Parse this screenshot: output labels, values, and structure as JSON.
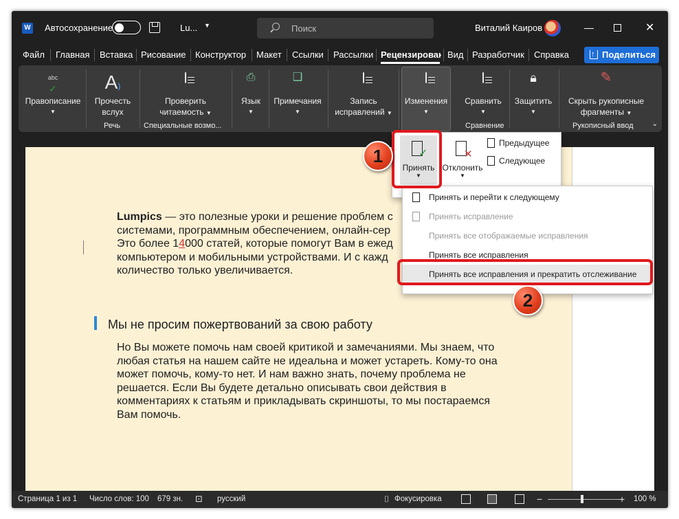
{
  "titlebar": {
    "app_icon_letter": "W",
    "autosave_label": "Автосохранение",
    "filename": "Lu...",
    "search_placeholder": "Поиск",
    "username": "Виталий Каиров"
  },
  "tabs": [
    "Файл",
    "Главная",
    "Вставка",
    "Рисование",
    "Конструктор",
    "Макет",
    "Ссылки",
    "Рассылки",
    "Рецензирование",
    "Вид",
    "Разработчик",
    "Справка"
  ],
  "active_tab": "Рецензирование",
  "share_label": "Поделиться",
  "ribbon": {
    "spelling": "Правописание",
    "read_aloud_1": "Прочесть",
    "read_aloud_2": "вслух",
    "check_access_1": "Проверить",
    "check_access_2": "читаемость",
    "language": "Язык",
    "comments": "Примечания",
    "track_1": "Запись",
    "track_2": "исправлений",
    "changes": "Изменения",
    "compare": "Сравнить",
    "protect": "Защитить",
    "hide_ink_1": "Скрыть рукописные",
    "hide_ink_2": "фрагменты",
    "group_speech": "Речь",
    "group_access": "Специальные возмо...",
    "group_compare": "Сравнение",
    "group_ink": "Рукописный ввод",
    "spelling_sub": "abc"
  },
  "changes_panel": {
    "accept": "Принять",
    "reject": "Отклонить",
    "previous": "Предыдущее",
    "next": "Следующее"
  },
  "accept_menu": [
    "Принять и перейти к следующему",
    "Принять исправление",
    "Принять все отображаемые исправления",
    "Принять все исправления",
    "Принять все исправления и прекратить отслеживание"
  ],
  "document": {
    "p1_bold": "Lumpics",
    "p1_line1": " — это полезные уроки и решение проблем с",
    "p1_line2": "системами, программным обеспечением, онлайн-сер",
    "p1_line3_a": "Это более 1",
    "p1_line3_changed": "4",
    "p1_line3_b": "000 статей, которые помогут Вам в ежед",
    "p1_line4": "компьютером и мобильными устройствами. И с кажд",
    "p1_line5": "количество только увеличивается.",
    "heading": "Мы не просим пожертвований за свою работу",
    "p2_line1": "Но Вы можете помочь нам своей критикой и замечаниями. Мы знаем, что",
    "p2_line2": "любая статья на нашем сайте не идеальна и может устареть. Кому-то она",
    "p2_line3": "может помочь, кому-то нет. И нам важно знать, почему проблема не",
    "p2_line4": "решается. Если Вы будете детально описывать свои действия в",
    "p2_line5": "комментариях к статьям и прикладывать скриншоты, то мы постараемся",
    "p2_line6": "Вам помочь."
  },
  "callouts": [
    "1",
    "2"
  ],
  "statusbar": {
    "page": "Страница 1 из 1",
    "words": "Число слов: 100",
    "chars": "679 зн.",
    "language": "русский",
    "focus": "Фокусировка",
    "zoom": "100 %",
    "minus": "−",
    "plus": "+"
  },
  "colors": {
    "accent": "#1e6ed8",
    "callout_red": "#e0191e",
    "page_bg": "#fdf1d4",
    "tracked_change": "#d13438"
  }
}
